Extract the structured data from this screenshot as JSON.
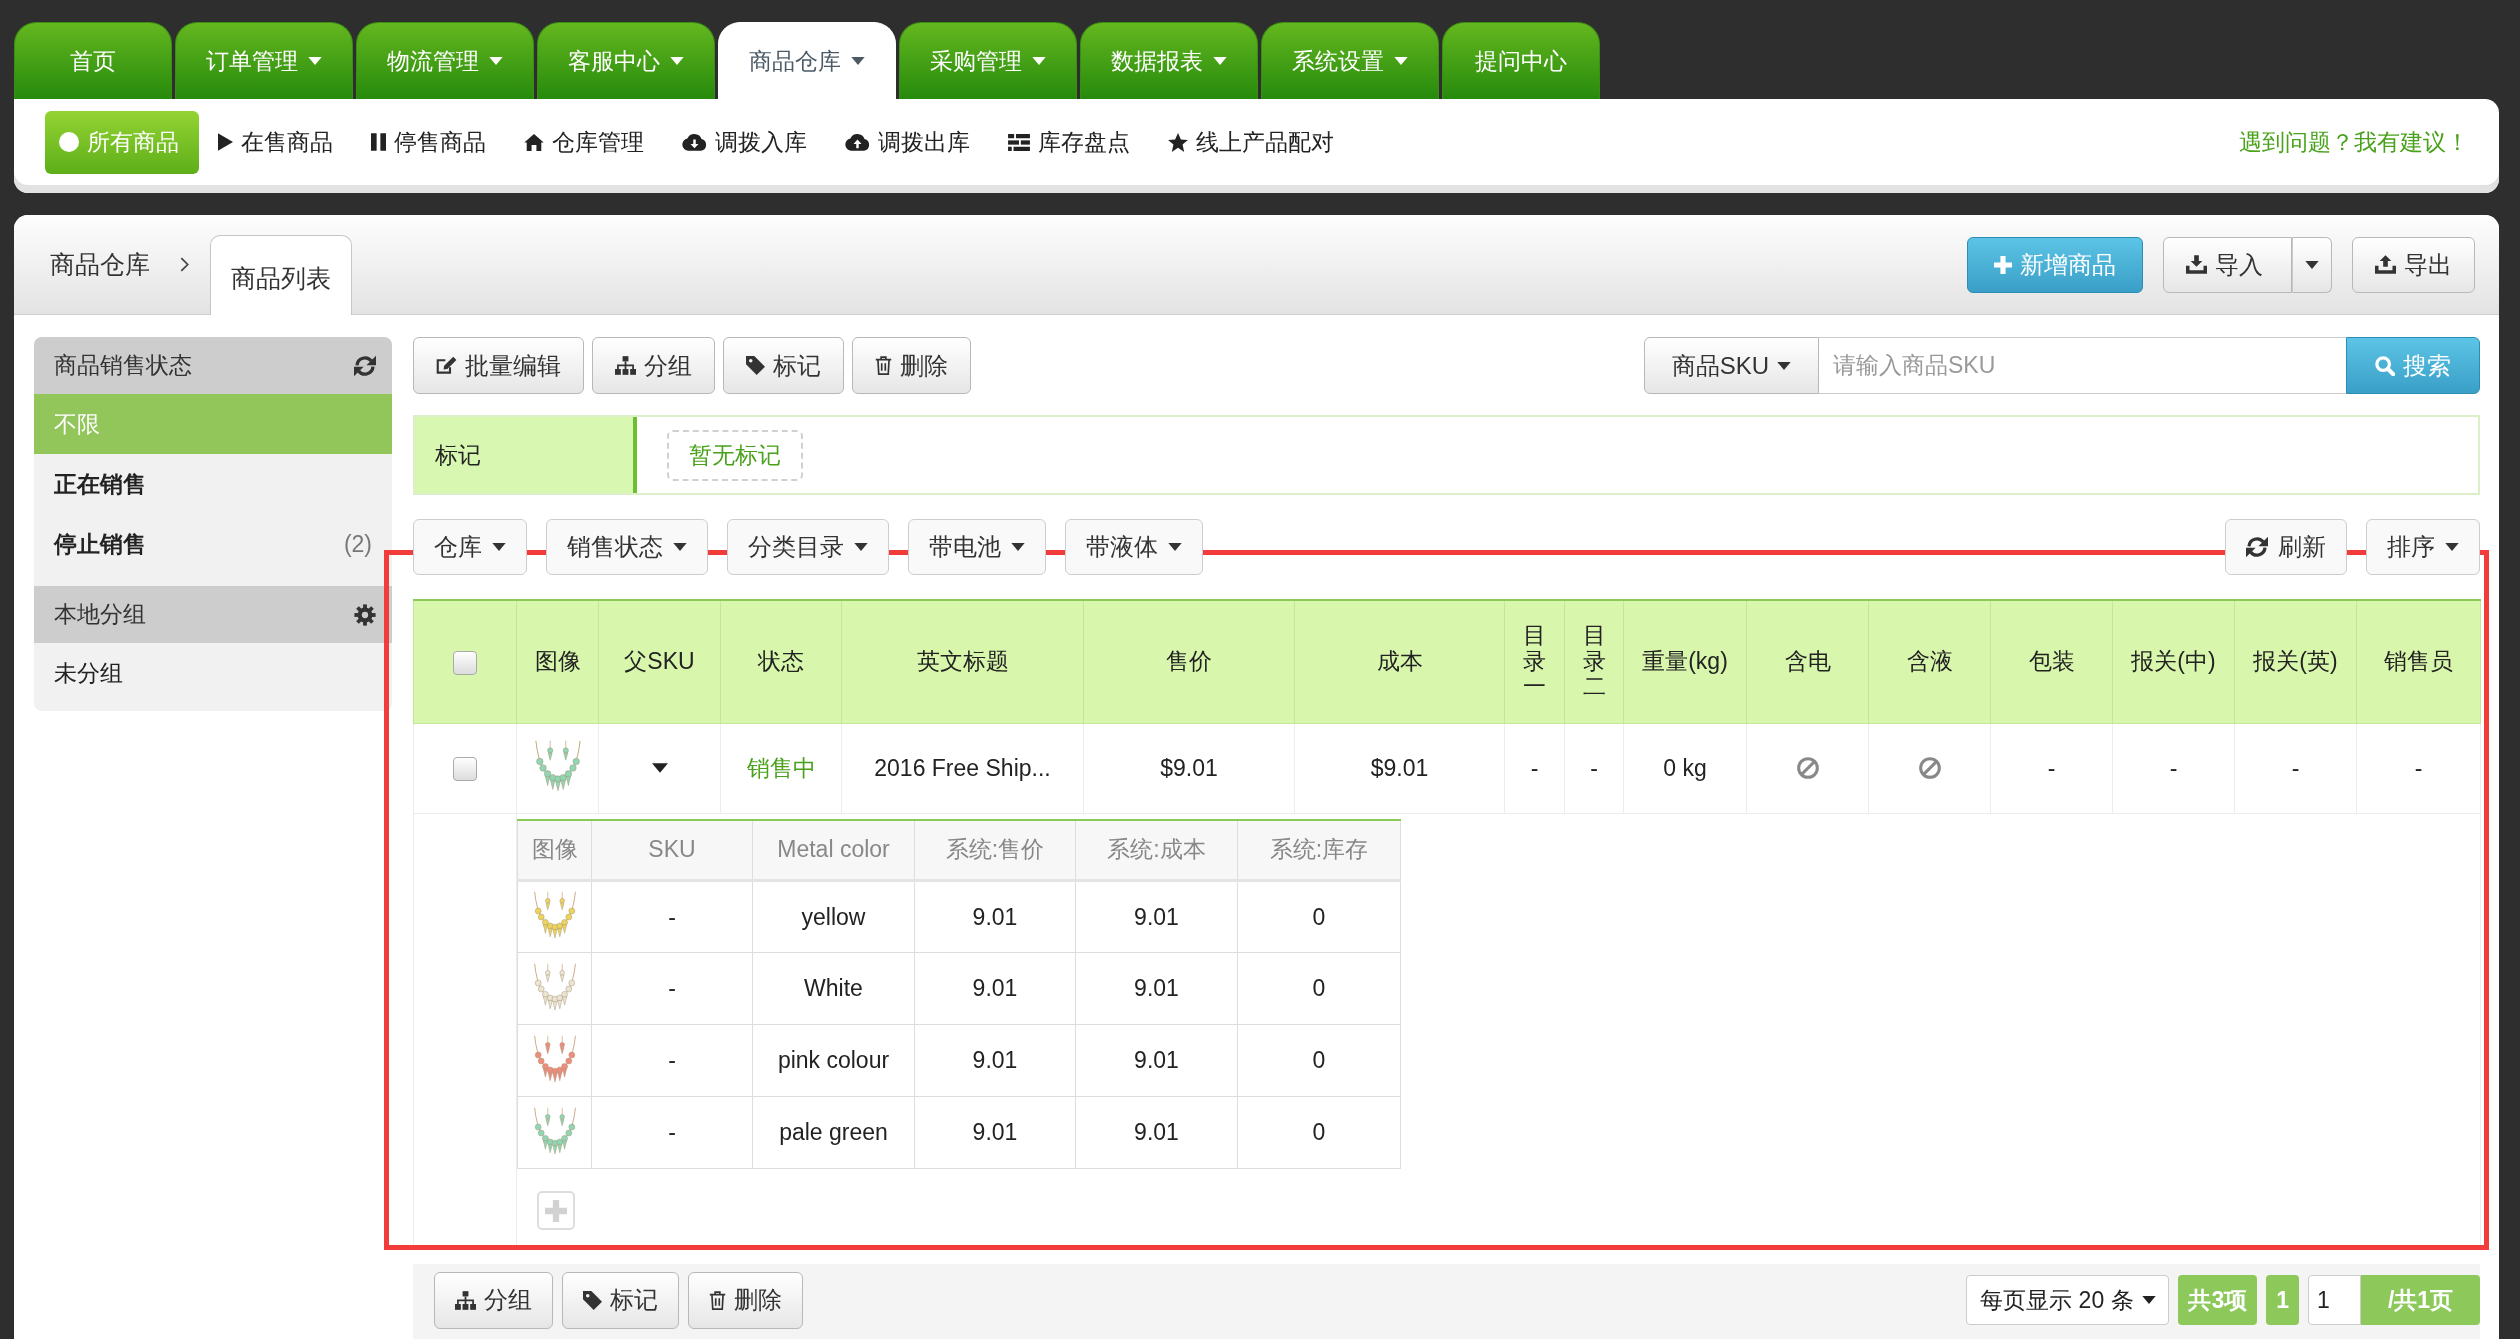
{
  "nav_tabs": [
    {
      "label": "首页",
      "dropdown": false,
      "selected": false
    },
    {
      "label": "订单管理",
      "dropdown": true,
      "selected": false
    },
    {
      "label": "物流管理",
      "dropdown": true,
      "selected": false
    },
    {
      "label": "客服中心",
      "dropdown": true,
      "selected": false
    },
    {
      "label": "商品仓库",
      "dropdown": true,
      "selected": true
    },
    {
      "label": "采购管理",
      "dropdown": true,
      "selected": false
    },
    {
      "label": "数据报表",
      "dropdown": true,
      "selected": false
    },
    {
      "label": "系统设置",
      "dropdown": true,
      "selected": false
    },
    {
      "label": "提问中心",
      "dropdown": false,
      "selected": false
    }
  ],
  "sub_nav": {
    "items": [
      {
        "label": "所有商品",
        "selected": true
      },
      {
        "label": "在售商品",
        "selected": false
      },
      {
        "label": "停售商品",
        "selected": false
      },
      {
        "label": "仓库管理",
        "selected": false
      },
      {
        "label": "调拨入库",
        "selected": false
      },
      {
        "label": "调拨出库",
        "selected": false
      },
      {
        "label": "库存盘点",
        "selected": false
      },
      {
        "label": "线上产品配对",
        "selected": false
      }
    ],
    "feedback_link": "遇到问题？我有建议！"
  },
  "page_header": {
    "breadcrumb": "商品仓库",
    "current_tab": "商品列表",
    "add_button": "新增商品",
    "import_button": "导入",
    "export_button": "导出"
  },
  "sidebar": {
    "sections": [
      {
        "kind": "status",
        "title": "商品销售状态",
        "items": [
          {
            "label": "不限",
            "selected": true
          },
          {
            "label": "正在销售",
            "selected": false
          },
          {
            "label": "停止销售",
            "count": "(2)",
            "selected": false
          }
        ]
      },
      {
        "kind": "group",
        "title": "本地分组",
        "items": [
          {
            "label": "未分组",
            "selected": false
          }
        ]
      }
    ]
  },
  "toolbar": {
    "buttons": [
      "批量编辑",
      "分组",
      "标记",
      "删除"
    ],
    "search": {
      "scope": "商品SKU",
      "placeholder": "请输入商品SKU",
      "button": "搜索"
    }
  },
  "tag_bar": {
    "label": "标记",
    "empty_tag": "暂无标记"
  },
  "filters": {
    "buttons": [
      "仓库",
      "销售状态",
      "分类目录",
      "带电池",
      "带液体"
    ],
    "refresh_button": "刷新",
    "sort_button": "排序"
  },
  "table": {
    "select_all": {
      "checked": false
    },
    "columns": [
      "图像",
      "父SKU",
      "状态",
      "英文标题",
      "售价",
      "成本",
      "目录一",
      "目录二",
      "重量(kg)",
      "含电",
      "含液",
      "包装",
      "报关(中)",
      "报关(英)",
      "销售员"
    ],
    "rows": [
      {
        "checked": false,
        "color": "#8fd6b4",
        "expanded": true,
        "status": "销售中",
        "title": "2016 Free Ship...",
        "price": "$9.01",
        "cost": "$9.01",
        "category_1": "-",
        "category_2": "-",
        "weight": "0 kg",
        "has_battery": false,
        "has_liquid": false,
        "packaging": "-",
        "customs_cn": "-",
        "customs_en": "-",
        "salesperson": "-",
        "variants": {
          "columns": [
            "图像",
            "SKU",
            "Metal color",
            "系统:售价",
            "系统:成本",
            "系统:库存"
          ],
          "rows": [
            {
              "color": "#ecd45c",
              "sku": "-",
              "metal_color": "yellow",
              "price": "9.01",
              "cost": "9.01",
              "stock": "0"
            },
            {
              "color": "#ece4d2",
              "sku": "-",
              "metal_color": "White",
              "price": "9.01",
              "cost": "9.01",
              "stock": "0"
            },
            {
              "color": "#f08c7c",
              "sku": "-",
              "metal_color": "pink colour",
              "price": "9.01",
              "cost": "9.01",
              "stock": "0"
            },
            {
              "color": "#8fd6b4",
              "sku": "-",
              "metal_color": "pale green",
              "price": "9.01",
              "cost": "9.01",
              "stock": "0"
            }
          ]
        }
      }
    ]
  },
  "footer": {
    "buttons": [
      "分组",
      "标记",
      "删除"
    ],
    "page_size": "每页显示 20 条",
    "total": "共3项",
    "current_page": "1",
    "page_input": "1",
    "page_count": "/共1页"
  }
}
